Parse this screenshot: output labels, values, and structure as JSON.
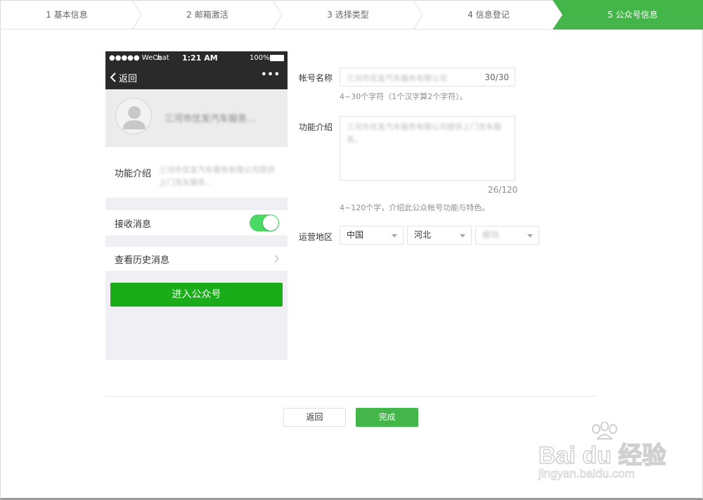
{
  "steps": [
    {
      "label": "1 基本信息"
    },
    {
      "label": "2 邮箱激活"
    },
    {
      "label": "3 选择类型"
    },
    {
      "label": "4 信息登记"
    },
    {
      "label": "5 公众号信息"
    }
  ],
  "phone": {
    "carrier": "●●●●● WeChat",
    "time": "1:21 AM",
    "battery": "100%",
    "back_label": "返回",
    "more": "•••",
    "account_name": "三河市优发汽车服务...",
    "intro_label": "功能介绍",
    "intro_text": "三河市优发汽车服务有限公司提供上门洗车服务...",
    "receive_label": "接收消息",
    "receive_enabled": true,
    "history_label": "查看历史消息",
    "enter_label": "进入公众号"
  },
  "form": {
    "name_label": "帐号名称",
    "name_value": "三河市优发汽车服务有限公司",
    "name_count": "30/30",
    "name_tip": "4~30个字符（1个汉字算2个字符）。",
    "intro_label": "功能介绍",
    "intro_value": "三河市优发汽车服务有限公司提供上门洗车服务。",
    "intro_count": "26/120",
    "intro_tip": "4~120个字，介绍此公众帐号功能与特色。",
    "region_label": "运营地区",
    "country": "中国",
    "province": "河北",
    "city": "廊坊"
  },
  "buttons": {
    "back_label": "返回",
    "done_label": "完成"
  },
  "watermark": {
    "brand": "Bai du 经验",
    "url": "jingyan.baidu.com"
  },
  "colors": {
    "accent": "#44b549",
    "wechat_green": "#1aad19",
    "switch_on": "#4cd964"
  }
}
